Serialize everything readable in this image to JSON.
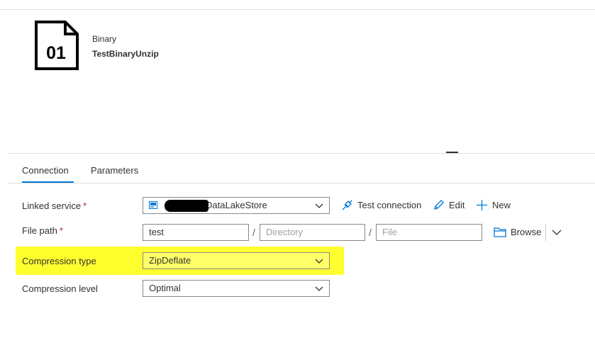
{
  "dataset": {
    "type_label": "Binary",
    "name": "TestBinaryUnzip",
    "icon_text": "01",
    "icon": "binary-file-icon"
  },
  "tabs": [
    {
      "label": "Connection",
      "active": true
    },
    {
      "label": "Parameters",
      "active": false
    }
  ],
  "form": {
    "linked_service": {
      "label": "Linked service",
      "required_mark": "*",
      "value": "DataLakeStore",
      "icon": "storage-icon"
    },
    "file_path": {
      "label": "File path",
      "required_mark": "*",
      "container_value": "test",
      "directory_placeholder": "Directory",
      "file_placeholder": "File",
      "separator": "/"
    },
    "compression_type": {
      "label": "Compression type",
      "value": "ZipDeflate"
    },
    "compression_level": {
      "label": "Compression level",
      "value": "Optimal"
    }
  },
  "actions": {
    "test_connection": "Test connection",
    "edit": "Edit",
    "new": "New",
    "browse": "Browse"
  },
  "colors": {
    "accent": "#0078d4",
    "highlight": "#ffff2e",
    "required": "#a4262c"
  }
}
